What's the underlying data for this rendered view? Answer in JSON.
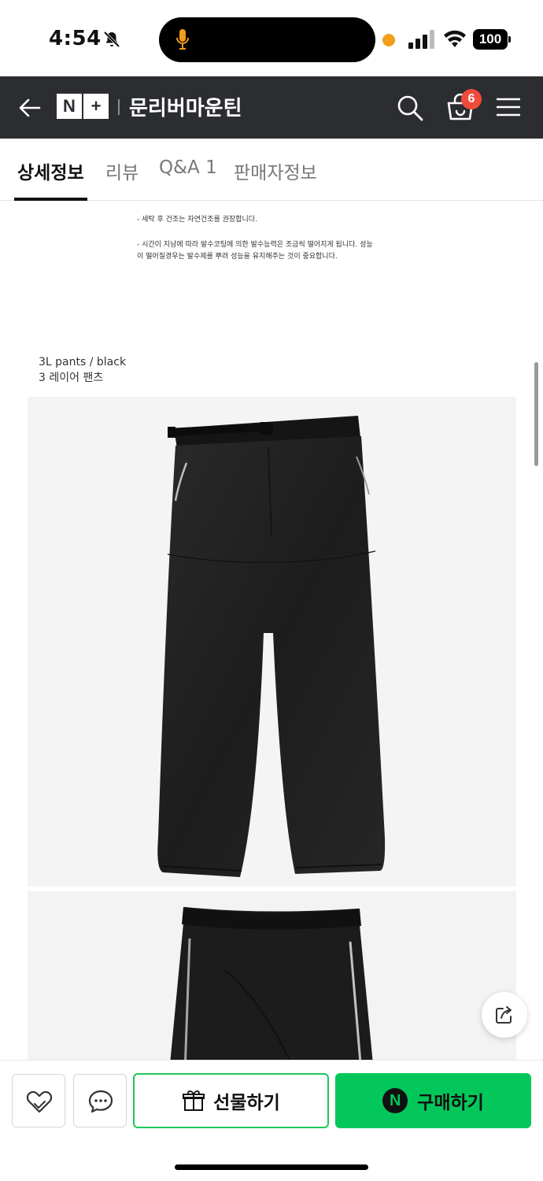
{
  "status_bar": {
    "time": "4:54",
    "battery": "100",
    "icons": [
      "bell-slash-icon",
      "microphone-icon",
      "recording-dot",
      "cellular-signal-icon",
      "wifi-icon",
      "battery-icon"
    ]
  },
  "header": {
    "logo_n": "N",
    "logo_plus": "+",
    "store_name": "문리버마운틴",
    "cart_count": "6",
    "icons": [
      "back-arrow-icon",
      "search-icon",
      "cart-icon",
      "hamburger-menu-icon"
    ]
  },
  "tabs": [
    {
      "label": "상세정보",
      "active": true
    },
    {
      "label": "리뷰",
      "active": false
    },
    {
      "label": "Q&A 1",
      "active": false
    },
    {
      "label": "판매자정보",
      "active": false
    }
  ],
  "detail": {
    "note_lines": [
      "- 세탁 후 건조는 자연건조를 권장합니다.",
      "- 시간이 지남에 따라 발수코팅에 의한 발수능력은 조금씩 떨어지게 됩니다. 성능",
      "이 떨어질경우는 발수제를 뿌려 성능을 유지해주는 것이 중요합니다."
    ],
    "caption_line1": "3L pants / black",
    "caption_line2": "3 레이어 팬츠"
  },
  "bottom_bar": {
    "gift_label": "선물하기",
    "buy_label": "구매하기",
    "npay_mark": "N",
    "icons": [
      "wishlist-heart-icon",
      "chat-bubble-icon",
      "gift-icon",
      "share-icon"
    ]
  },
  "colors": {
    "header_bg": "#2b2d31",
    "accent_green": "#03c75a",
    "badge_red": "#f04a3a"
  }
}
